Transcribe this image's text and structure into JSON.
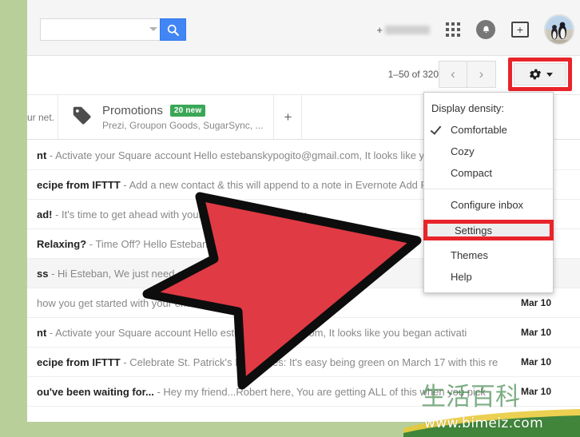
{
  "header": {
    "search": {
      "value": "",
      "placeholder": "",
      "button_icon": "search-icon",
      "caret_icon": "chevron-down-icon"
    },
    "plus_label": "+",
    "account_name_blurred": "",
    "icons": {
      "apps": "apps-grid-icon",
      "notifications": "bell-icon",
      "share": "share-plus-icon",
      "avatar": "avatar-penguins"
    }
  },
  "toolbar": {
    "pager": "1–50 of 320",
    "prev_label": "‹",
    "next_label": "›",
    "gear_icon": "gear-icon",
    "gear_caret_icon": "chevron-down-icon",
    "gear_highlight_color": "#e8242a"
  },
  "tabs": {
    "previous_tab_truncated": "ur net...",
    "promotions": {
      "icon": "tag-icon",
      "title": "Promotions",
      "badge": "20 new",
      "badge_color": "#3aa757",
      "subtitle": "Prezi, Groupon Goods, SugarSync, ..."
    },
    "add_tab_label": "+"
  },
  "menu": {
    "title": "Display density:",
    "items": [
      {
        "label": "Comfortable",
        "checked": true
      },
      {
        "label": "Cozy",
        "checked": false
      },
      {
        "label": "Compact",
        "checked": false
      },
      {
        "label": "Configure inbox",
        "checked": false
      },
      {
        "label": "Settings",
        "checked": false,
        "highlighted": true
      },
      {
        "label": "Themes",
        "checked": false
      },
      {
        "label": "Help",
        "checked": false
      }
    ]
  },
  "mail_rows": [
    {
      "subject": "nt",
      "snippet": " - Activate your Square account Hello estebanskypogito@gmail.com, It looks like you beg",
      "date": "",
      "read": false
    },
    {
      "subject": "ecipe from IFTTT",
      "snippet": " - Add a new contact & this will append to a note in Evernote Add Recip",
      "date": "",
      "read": false
    },
    {
      "subject": "ad!",
      "snippet": " - It's time to get ahead with your busine                                 iness? Are you",
      "date": "",
      "read": false
    },
    {
      "subject": "Relaxing?",
      "snippet": " - Time Off? Hello Esteban, You can                                       cks fo",
      "date": "",
      "read": false
    },
    {
      "subject": "ss",
      "snippet": " - Hi Esteban, We just need                                    are files and f",
      "date": "",
      "read": true
    },
    {
      "subject": "",
      "snippet": "how you get started with your                 ent. Welcom              ank you for signing up",
      "date": "Mar 10",
      "read": false
    },
    {
      "subject": "nt",
      "snippet": " - Activate your Square account Hello estebansky             gmail.com, It looks like you began activati",
      "date": "Mar 10",
      "read": false
    },
    {
      "subject": "ecipe from IFTTT",
      "snippet": " - Celebrate St. Patrick's Day Notes: It's easy being green on March 17 with this re",
      "date": "Mar 10",
      "read": false
    },
    {
      "subject": "ou've been waiting for...",
      "snippet": " - Hey my friend...Robert here, You are getting ALL of this when you pick",
      "date": "Mar 10",
      "read": false
    }
  ],
  "annotation": {
    "arrow_color": "#e03a44",
    "arrow_outline": "#0d0d0d"
  },
  "watermark": {
    "characters": "生活百科",
    "url": "www.bimeiz.com"
  },
  "page_background": "#b9cf9a"
}
